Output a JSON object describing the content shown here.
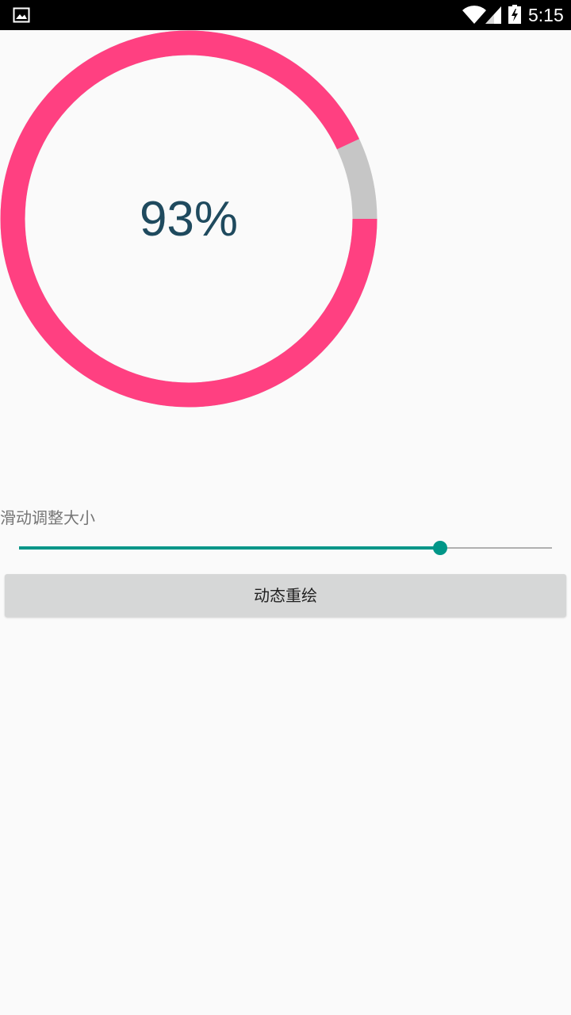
{
  "status_bar": {
    "time": "5:15",
    "icons": [
      "gallery-icon",
      "wifi-icon",
      "signal-icon",
      "battery-charging-icon"
    ]
  },
  "progress": {
    "label": "93%",
    "value": 0.93,
    "ring_color": "#ff4081",
    "track_color": "#c6c6c6",
    "text_color": "#1f4a5e"
  },
  "slider": {
    "caption": "滑动调整大小",
    "value": 0.79,
    "active_color": "#009688",
    "inactive_color": "#b0b0b0"
  },
  "button": {
    "label": "动态重绘"
  }
}
